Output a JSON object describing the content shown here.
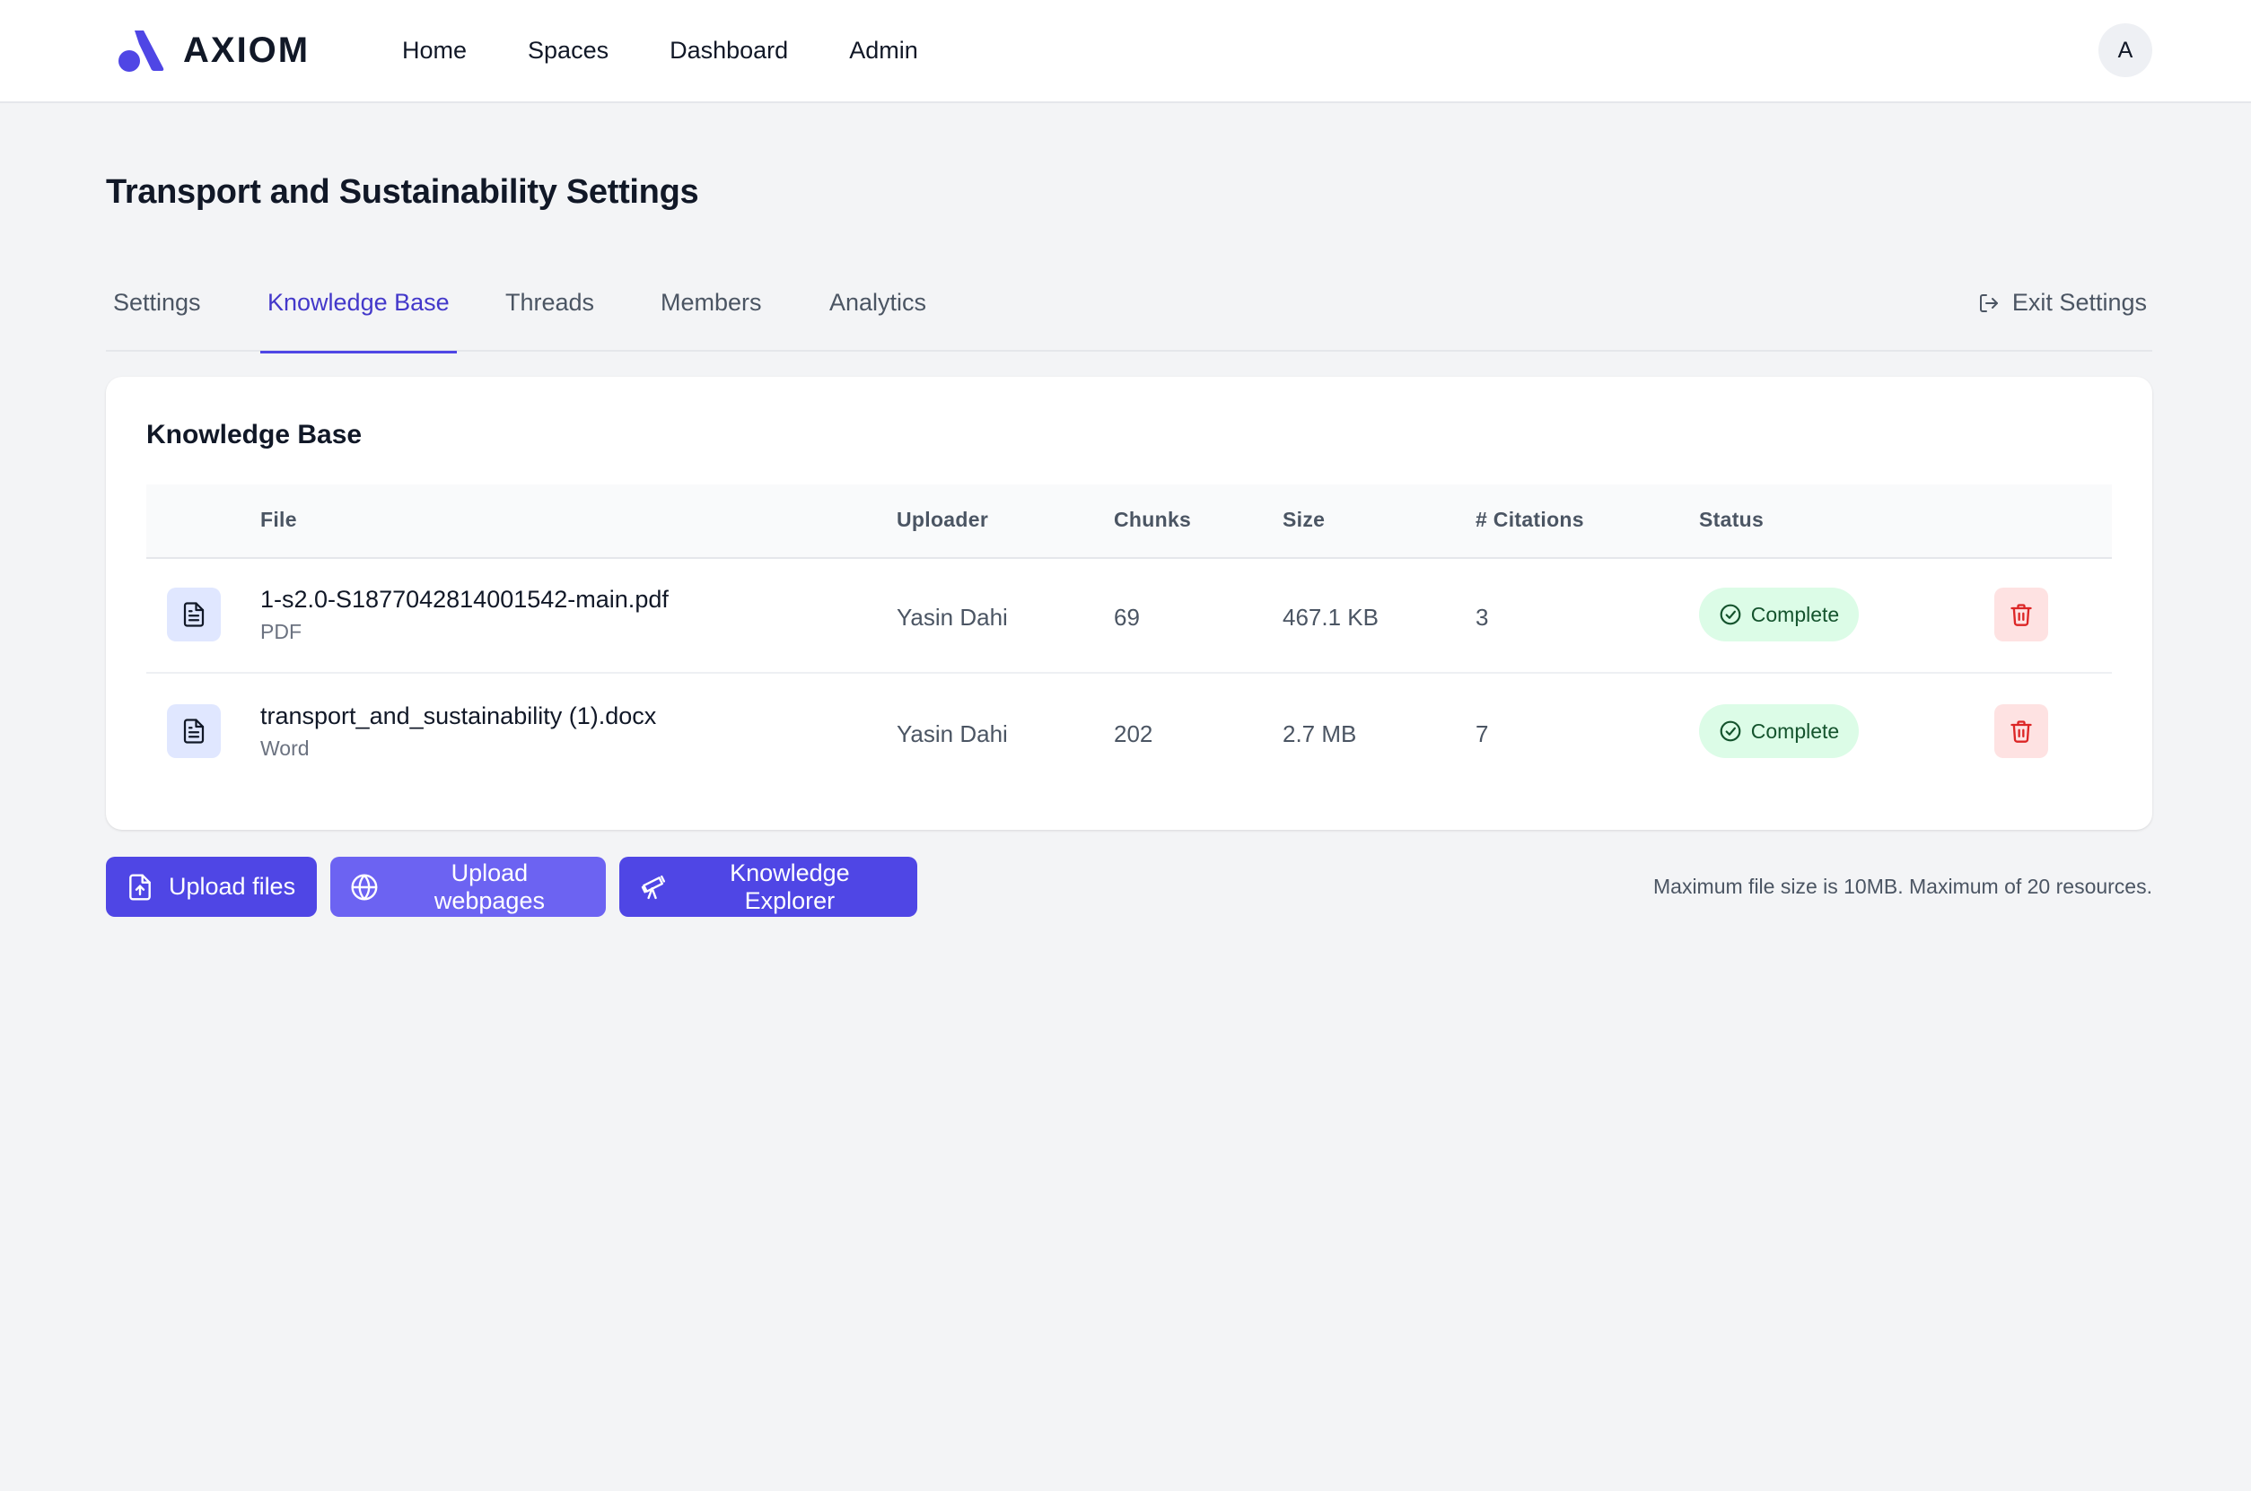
{
  "brand": {
    "name": "AXIOM",
    "logo_icon": "axiom-logo"
  },
  "nav": {
    "items": [
      {
        "label": "Home"
      },
      {
        "label": "Spaces"
      },
      {
        "label": "Dashboard"
      },
      {
        "label": "Admin"
      }
    ],
    "avatar_initial": "A"
  },
  "page": {
    "title": "Transport and Sustainability Settings"
  },
  "tabs": {
    "items": [
      {
        "label": "Settings",
        "active": false
      },
      {
        "label": "Knowledge Base",
        "active": true
      },
      {
        "label": "Threads",
        "active": false
      },
      {
        "label": "Members",
        "active": false
      },
      {
        "label": "Analytics",
        "active": false
      }
    ],
    "exit_label": "Exit Settings",
    "exit_icon": "exit-icon"
  },
  "knowledge_base": {
    "title": "Knowledge Base",
    "columns": [
      "File",
      "Uploader",
      "Chunks",
      "Size",
      "# Citations",
      "Status"
    ],
    "rows": [
      {
        "file_name": "1-s2.0-S1877042814001542-main.pdf",
        "file_type": "PDF",
        "uploader": "Yasin Dahi",
        "chunks": "69",
        "size": "467.1 KB",
        "citations": "3",
        "status": "Complete"
      },
      {
        "file_name": "transport_and_sustainability (1).docx",
        "file_type": "Word",
        "uploader": "Yasin Dahi",
        "chunks": "202",
        "size": "2.7 MB",
        "citations": "7",
        "status": "Complete"
      }
    ]
  },
  "actions": {
    "upload_files": "Upload files",
    "upload_webpages": "Upload webpages",
    "knowledge_explorer": "Knowledge Explorer",
    "limits_note": "Maximum file size is 10MB. Maximum of 20 resources."
  },
  "colors": {
    "accent": "#4f46e5",
    "accent_light": "#6c63f2",
    "status_complete_bg": "#dcfce7",
    "status_complete_text": "#14532d",
    "delete_bg": "#fee2e2",
    "delete_icon": "#dc2626"
  }
}
